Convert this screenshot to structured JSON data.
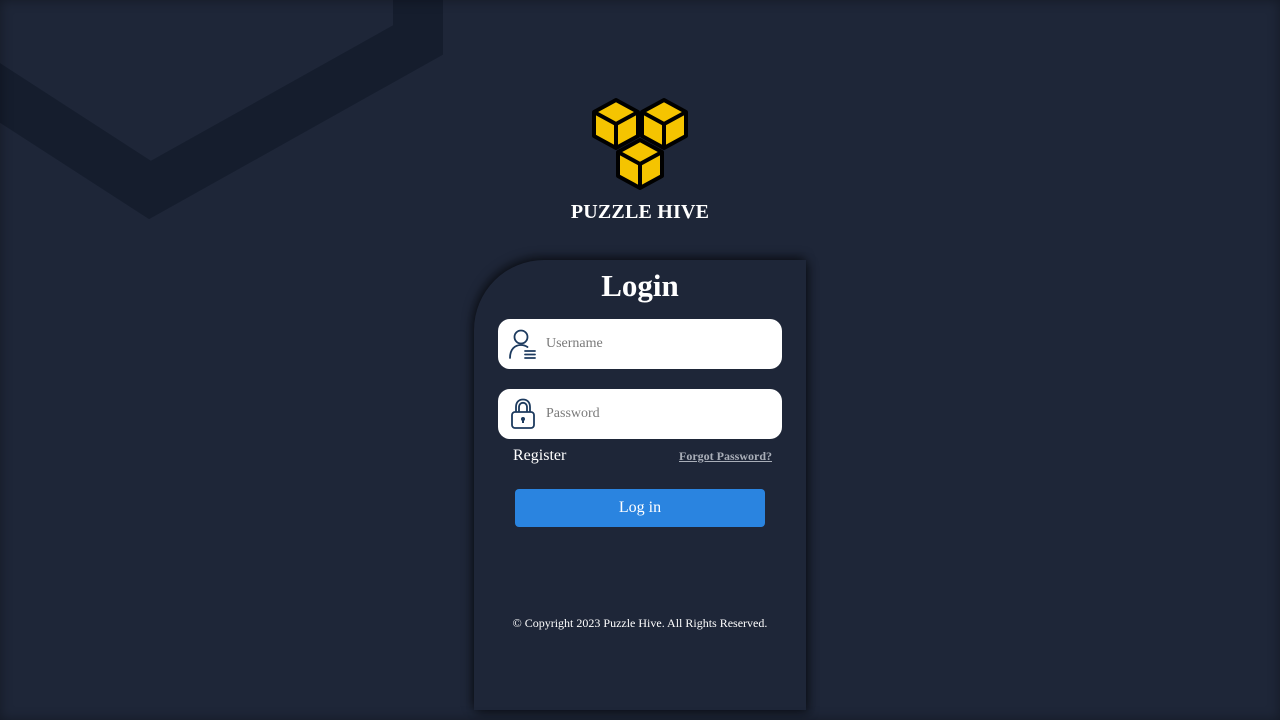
{
  "brand": {
    "name": "PUZZLE HIVE",
    "logo_icon": "honeycomb-cubes-icon",
    "logo_color": "#f5c400"
  },
  "login_form": {
    "title": "Login",
    "username": {
      "placeholder": "Username",
      "value": "",
      "icon": "user-list-icon"
    },
    "password": {
      "placeholder": "Password",
      "value": "",
      "icon": "padlock-icon"
    },
    "register_label": "Register",
    "forgot_password_label": "Forgot Password?",
    "submit_label": "Log in"
  },
  "footer": {
    "copyright": "© Copyright 2023 Puzzle Hive. All Rights Reserved."
  },
  "colors": {
    "background": "#1e2638",
    "accent": "#2a84e0",
    "input_background": "#ffffff",
    "icon_color": "#1c3a5e"
  }
}
